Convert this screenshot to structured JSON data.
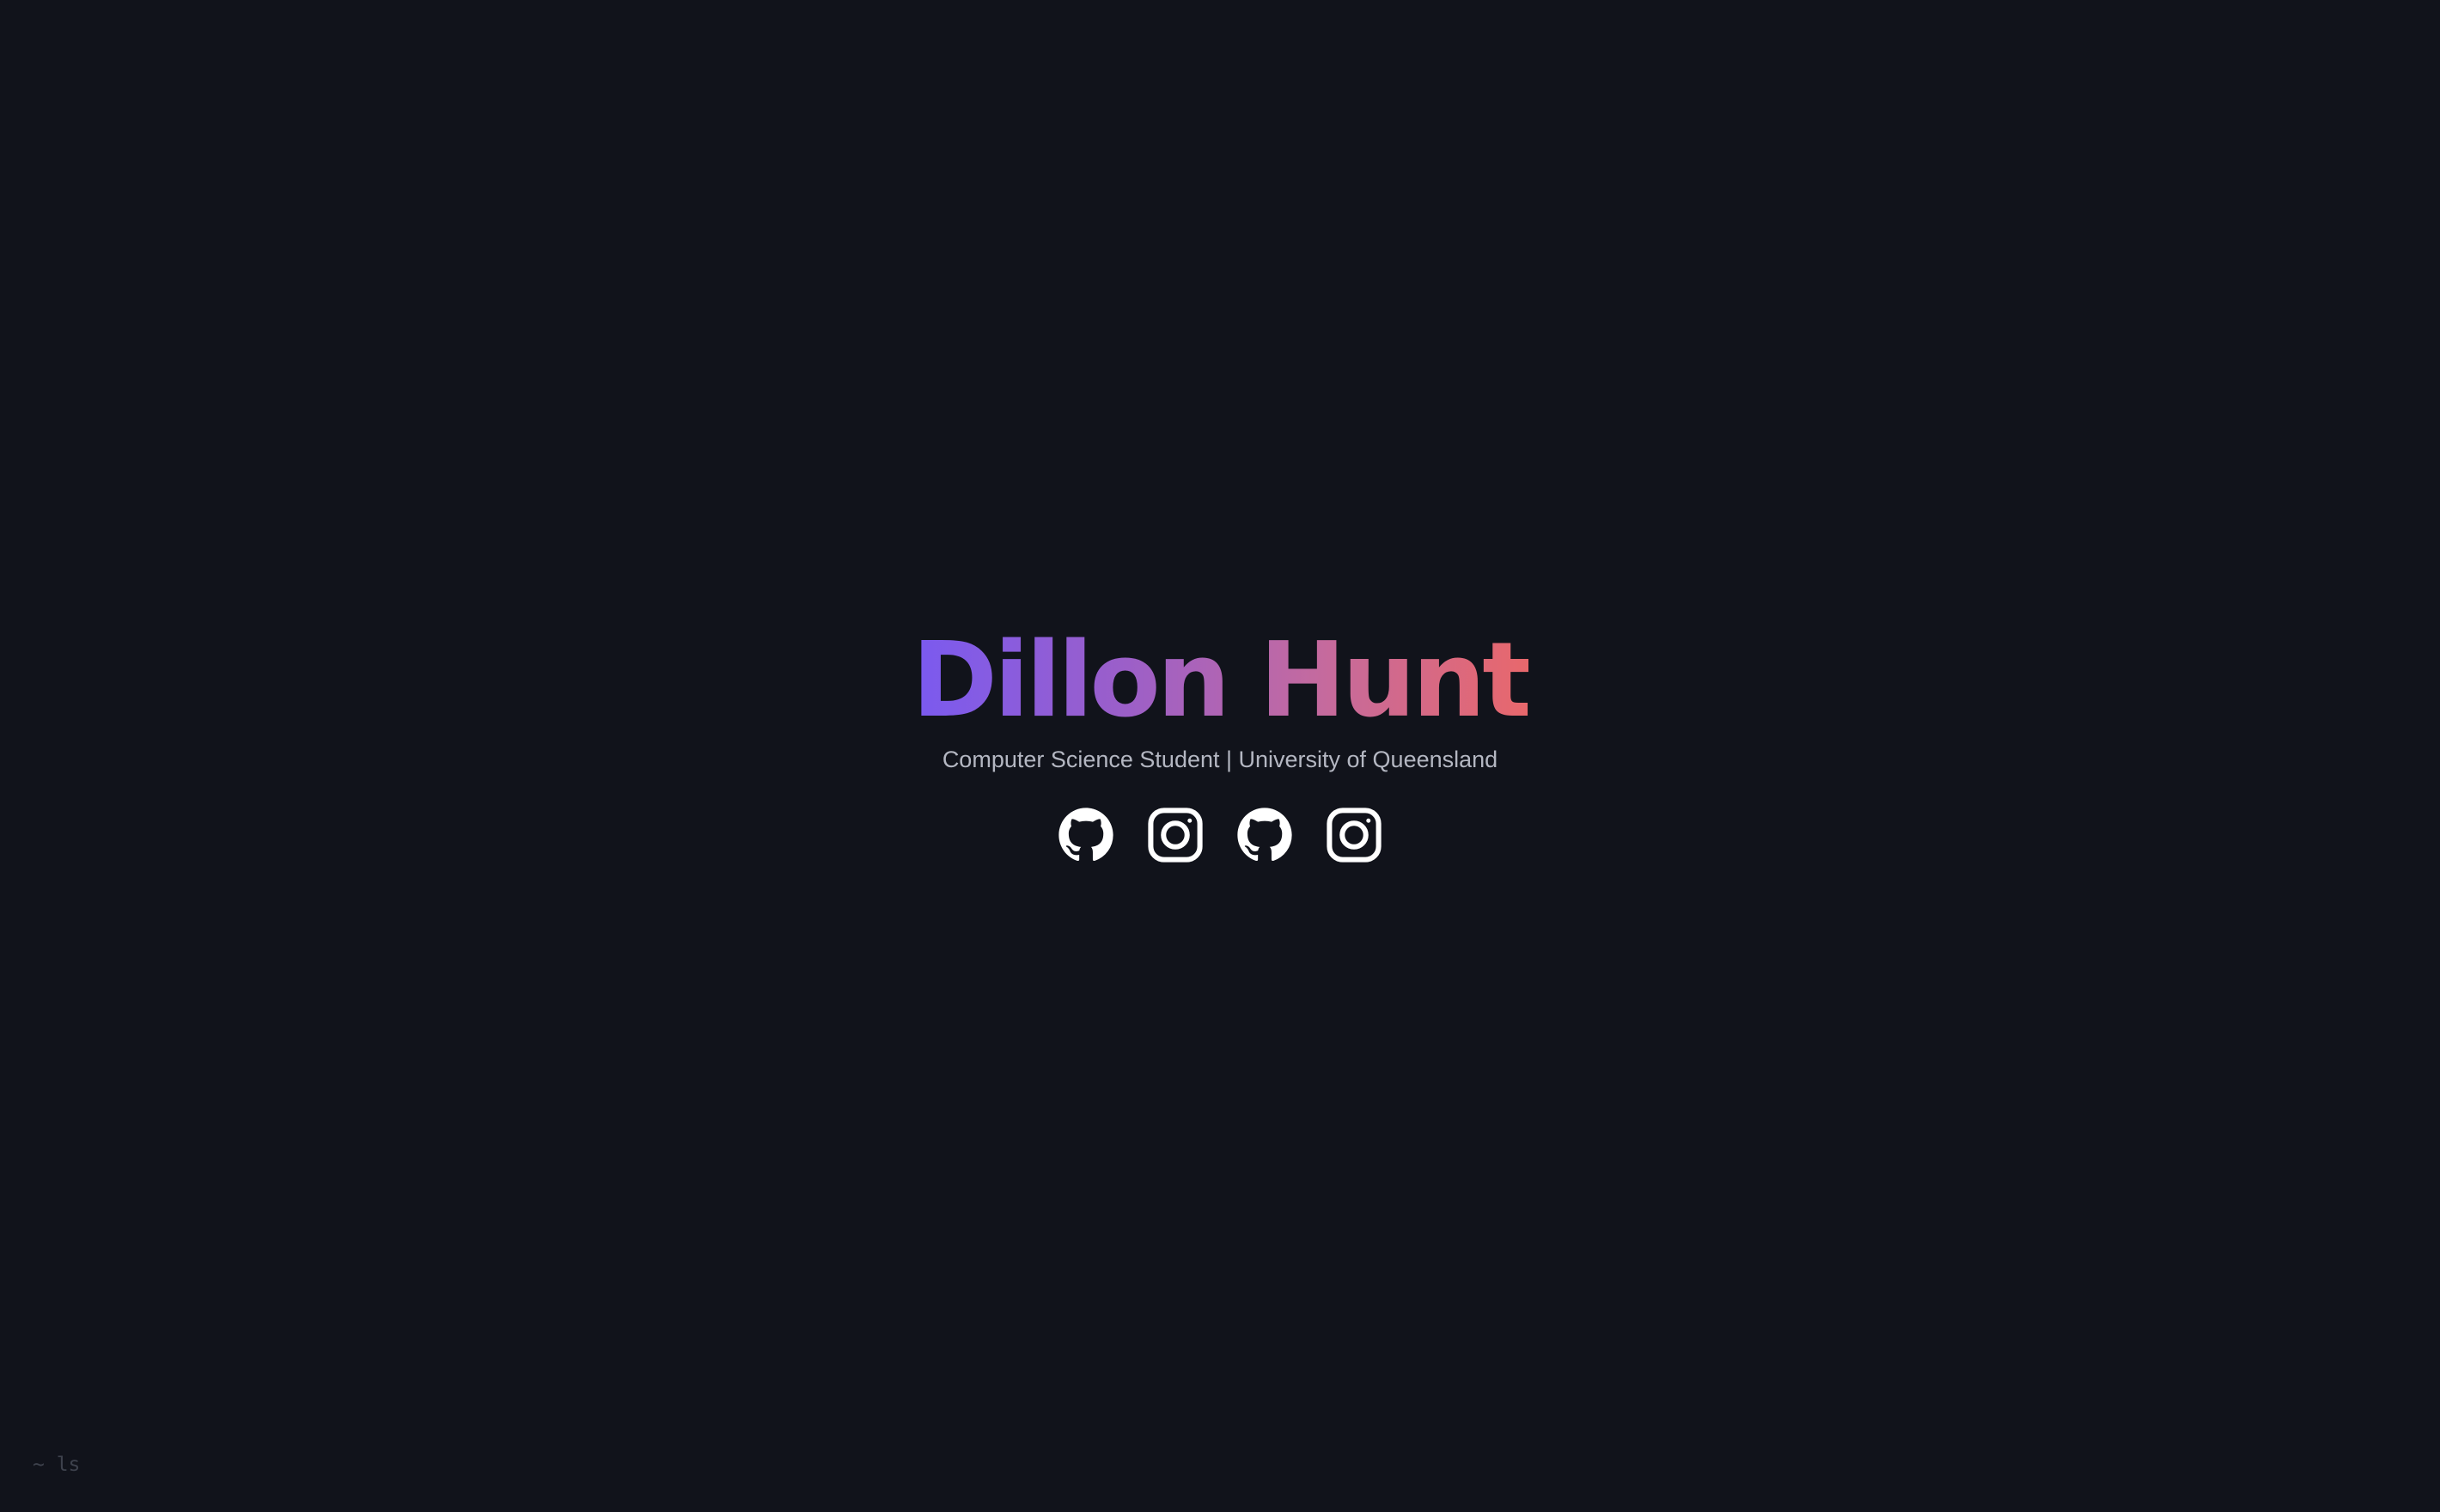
{
  "profile": {
    "name": "Dillon Hunt",
    "subtitle": "Computer Science Student | University of Queensland"
  },
  "socials": [
    {
      "icon": "github-icon"
    },
    {
      "icon": "instagram-icon"
    },
    {
      "icon": "github-icon"
    },
    {
      "icon": "instagram-icon"
    }
  ],
  "terminal": {
    "prompt": "~ ls"
  },
  "colors": {
    "background": "#11131b",
    "gradient_start": "#7a5af0",
    "gradient_end": "#e8686c",
    "subtitle": "#b4b7c2",
    "icon": "#ffffff",
    "prompt": "#3e424d"
  }
}
